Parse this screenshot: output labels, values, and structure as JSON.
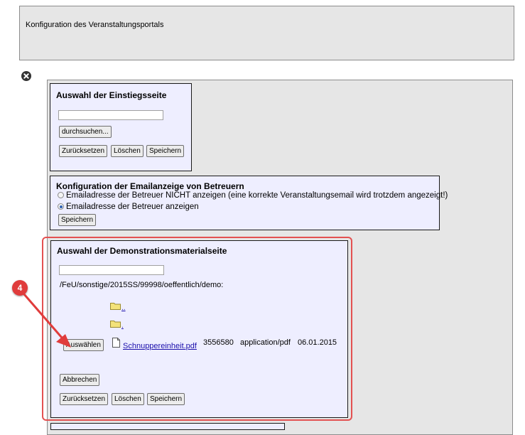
{
  "header": {
    "title": "Konfiguration des Veranstaltungsportals"
  },
  "einstieg": {
    "title": "Auswahl der Einstiegsseite",
    "input_value": "",
    "browse_label": "durchsuchen...",
    "reset_label": "Zurücksetzen",
    "delete_label": "Löschen",
    "save_label": "Speichern"
  },
  "email": {
    "title": "Konfiguration der Emailanzeige von Betreuern",
    "option1": "Emailadresse der Betreuer NICHT anzeigen (eine korrekte Veranstaltungsemail wird trotzdem angezeigt!)",
    "option2": "Emailadresse der Betreuer anzeigen",
    "selected": "option2",
    "save_label": "Speichern"
  },
  "demo": {
    "title": "Auswahl der Demonstrationsmaterialseite",
    "input_value": "",
    "path": "/FeU/sonstige/2015SS/99998/oeffentlich/demo:",
    "folders": [
      "..",
      "."
    ],
    "select_label": "Auswählen",
    "file": {
      "name": "Schnuppereinheit.pdf",
      "size": "3556580",
      "type": "application/pdf",
      "date": "06.01.2015"
    },
    "cancel_label": "Abbrechen",
    "reset_label": "Zurücksetzen",
    "delete_label": "Löschen",
    "save_label": "Speichern"
  },
  "annotation": {
    "step": "4",
    "color": "#e03c3c"
  }
}
